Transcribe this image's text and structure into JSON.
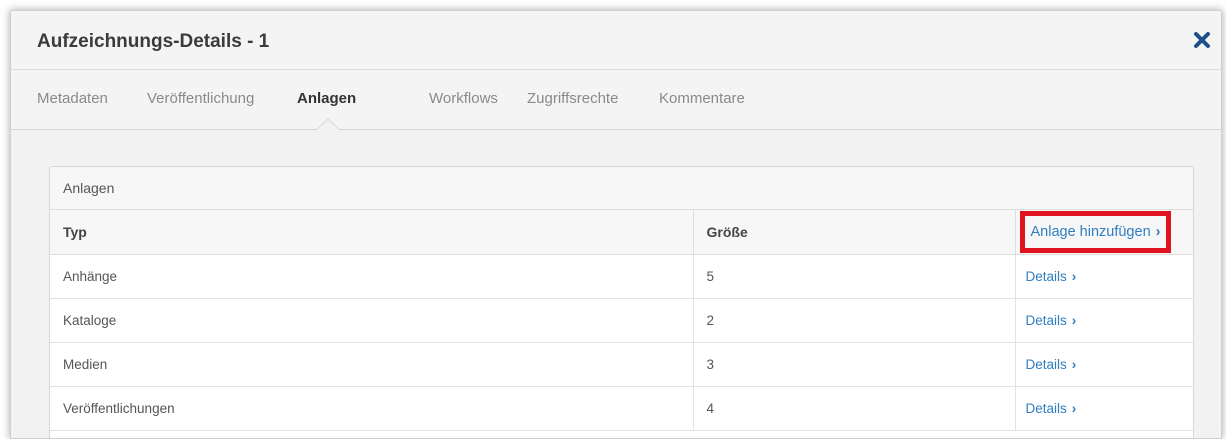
{
  "dialog": {
    "title": "Aufzeichnungs-Details - 1",
    "close_icon": "close-icon"
  },
  "tabs": [
    {
      "label": "Metadaten",
      "active": false
    },
    {
      "label": "Veröffentlichung",
      "active": false
    },
    {
      "label": "Anlagen",
      "active": true
    },
    {
      "label": "Workflows",
      "active": false
    },
    {
      "label": "Zugriffsrechte",
      "active": false
    },
    {
      "label": "Kommentare",
      "active": false
    }
  ],
  "panel": {
    "heading": "Anlagen",
    "columns": [
      "Typ",
      "Größe"
    ],
    "add_link": "Anlage hinzufügen",
    "rows": [
      {
        "type": "Anhänge",
        "size": "5",
        "link": "Details"
      },
      {
        "type": "Kataloge",
        "size": "2",
        "link": "Details"
      },
      {
        "type": "Medien",
        "size": "3",
        "link": "Details"
      },
      {
        "type": "Veröffentlichungen",
        "size": "4",
        "link": "Details"
      }
    ]
  },
  "colors": {
    "link": "#2f7ec1",
    "highlight": "#e0141e",
    "close_icon": "#1f4f8a"
  }
}
